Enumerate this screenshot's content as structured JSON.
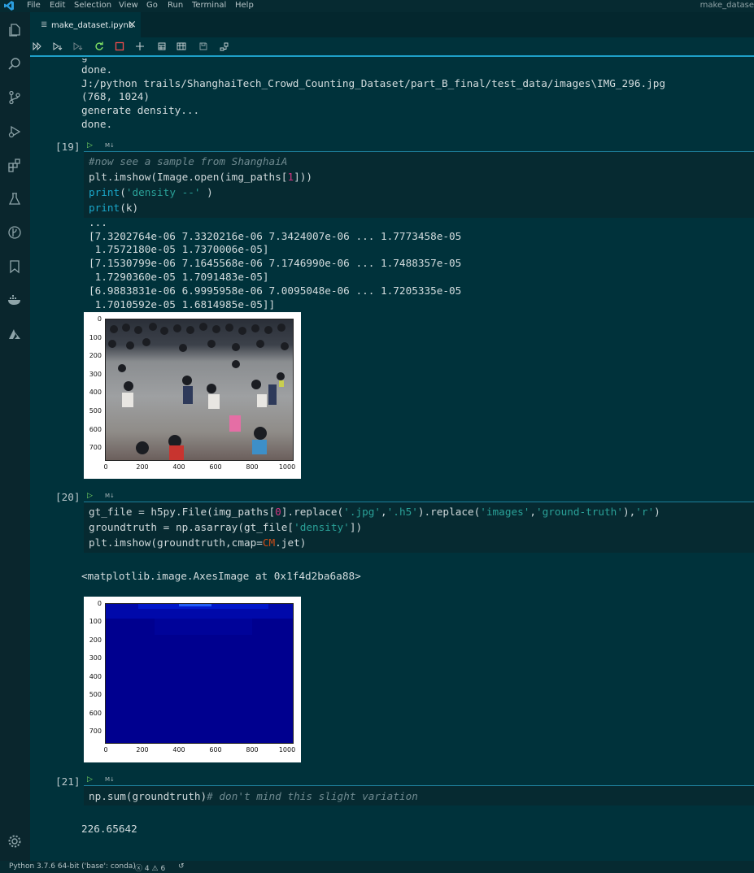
{
  "menubar": {
    "items": [
      "File",
      "Edit",
      "Selection",
      "View",
      "Go",
      "Run",
      "Terminal",
      "Help"
    ],
    "title": "make_datase"
  },
  "tab": {
    "label": "make_dataset.ipynb"
  },
  "cells": {
    "prev_output": [
      "done.",
      "J:/python trails/ShanghaiTech_Crowd_Counting_Dataset/part_B_final/test_data/images\\IMG_296.jpg",
      "(768, 1024)",
      "generate density...",
      "done."
    ],
    "c19": {
      "num": "[19]",
      "ml": "M↓",
      "code": {
        "comment": "#now see a sample from ShanghaiA",
        "l2a": "plt.imshow(Image.open(img_paths[",
        "l2b": "1",
        "l2c": "]))",
        "l3a": "print",
        "l3b": "(",
        "l3c": "'density --'",
        "l3d": " )",
        "l4a": "print",
        "l4b": "(k)"
      },
      "output": [
        "...",
        "[7.3202764e-06 7.3320216e-06 7.3424007e-06 ... 1.7773458e-05",
        " 1.7572180e-05 1.7370006e-05]",
        "[7.1530799e-06 7.1645568e-06 7.1746990e-06 ... 1.7488357e-05",
        " 1.7290360e-05 1.7091483e-05]",
        "[6.9883831e-06 6.9995958e-06 7.0095048e-06 ... 1.7205335e-05",
        " 1.7010592e-05 1.6814985e-05]]"
      ],
      "plot": {
        "yticks": [
          "0",
          "100",
          "200",
          "300",
          "400",
          "500",
          "600",
          "700"
        ],
        "xticks": [
          "0",
          "200",
          "400",
          "600",
          "800",
          "1000"
        ]
      }
    },
    "c20": {
      "num": "[20]",
      "ml": "M↓",
      "code": {
        "l1a": "gt_file = h5py.File(img_paths[",
        "l1b": "0",
        "l1c": "].replace(",
        "l1d": "'.jpg'",
        "l1e": ",",
        "l1f": "'.h5'",
        "l1g": ").replace(",
        "l1h": "'images'",
        "l1i": ",",
        "l1j": "'ground-truth'",
        "l1k": "),",
        "l1l": "'r'",
        "l1m": ")",
        "l2a": "groundtruth = np.asarray(gt_file[",
        "l2b": "'density'",
        "l2c": "])",
        "l3a": "plt.imshow(groundtruth,cmap=",
        "l3b": "CM",
        "l3c": ".jet)"
      },
      "output": "<matplotlib.image.AxesImage at 0x1f4d2ba6a88>",
      "plot": {
        "yticks": [
          "0",
          "100",
          "200",
          "300",
          "400",
          "500",
          "600",
          "700"
        ],
        "xticks": [
          "0",
          "200",
          "400",
          "600",
          "800",
          "1000"
        ]
      }
    },
    "c21": {
      "num": "[21]",
      "ml": "M↓",
      "code": {
        "l1a": "np.sum(groundtruth)",
        "l1b": "# don't mind this slight variation"
      },
      "output": "226.65642"
    }
  },
  "statusbar": {
    "python": "Python 3.7.6 64-bit ('base': conda)",
    "errors": "4",
    "warnings": "6"
  },
  "colors": {
    "background": "#00323b",
    "accent": "#1ea0c8",
    "jet_bg": "#00008f"
  }
}
